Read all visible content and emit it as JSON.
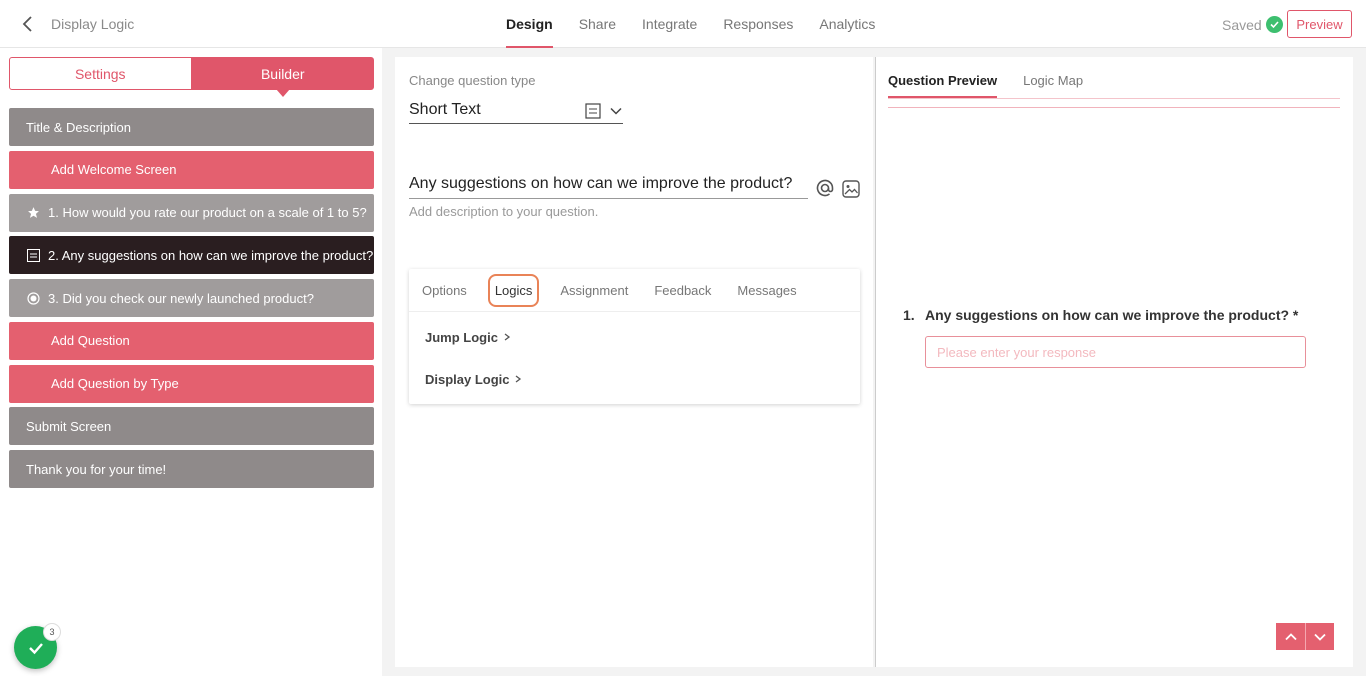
{
  "header": {
    "title": "Display Logic",
    "tabs": [
      {
        "label": "Design",
        "active": true
      },
      {
        "label": "Share",
        "active": false
      },
      {
        "label": "Integrate",
        "active": false
      },
      {
        "label": "Responses",
        "active": false
      },
      {
        "label": "Analytics",
        "active": false
      }
    ],
    "saved_label": "Saved",
    "preview_label": "Preview"
  },
  "sidebar": {
    "settings_label": "Settings",
    "builder_label": "Builder",
    "items": [
      {
        "label": "Title & Description",
        "style": "gray",
        "icon": "none"
      },
      {
        "label": "Add Welcome Screen",
        "style": "pink",
        "icon": "plus-icon"
      },
      {
        "label": "1. How would you rate our product on a scale of 1 to 5?",
        "style": "lgray",
        "icon": "star-icon"
      },
      {
        "label": "2. Any suggestions on how can we improve the product?",
        "style": "dark",
        "icon": "short-text-icon"
      },
      {
        "label": "3. Did you check our newly launched product?",
        "style": "lgray",
        "icon": "radio-icon"
      },
      {
        "label": "Add Question",
        "style": "pink",
        "icon": "plus-icon"
      },
      {
        "label": "Add Question by Type",
        "style": "pink",
        "icon": "plus-icon"
      },
      {
        "label": "Submit Screen",
        "style": "gray",
        "icon": "none"
      },
      {
        "label": "Thank you for your time!",
        "style": "gray",
        "icon": "none"
      }
    ],
    "fab_badge": "3"
  },
  "editor": {
    "change_type_label": "Change question type",
    "question_type": "Short Text",
    "question_title": "Any suggestions on how can we improve the product?",
    "description_placeholder": "Add description to your question.",
    "tabs": [
      {
        "label": "Options",
        "active": false
      },
      {
        "label": "Logics",
        "active": true
      },
      {
        "label": "Assignment",
        "active": false
      },
      {
        "label": "Feedback",
        "active": false
      },
      {
        "label": "Messages",
        "active": false
      }
    ],
    "jump_logic": "Jump Logic",
    "display_logic": "Display Logic"
  },
  "preview": {
    "tabs": [
      {
        "label": "Question Preview",
        "active": true
      },
      {
        "label": "Logic Map",
        "active": false
      }
    ],
    "question_number": "1.",
    "question_text": "Any suggestions on how can we improve the product? *",
    "input_placeholder": "Please enter your response"
  },
  "colors": {
    "accent": "#e0566a",
    "item_gray": "#8f8a8a",
    "item_selected": "#2a1e20",
    "success": "#1fae58"
  }
}
